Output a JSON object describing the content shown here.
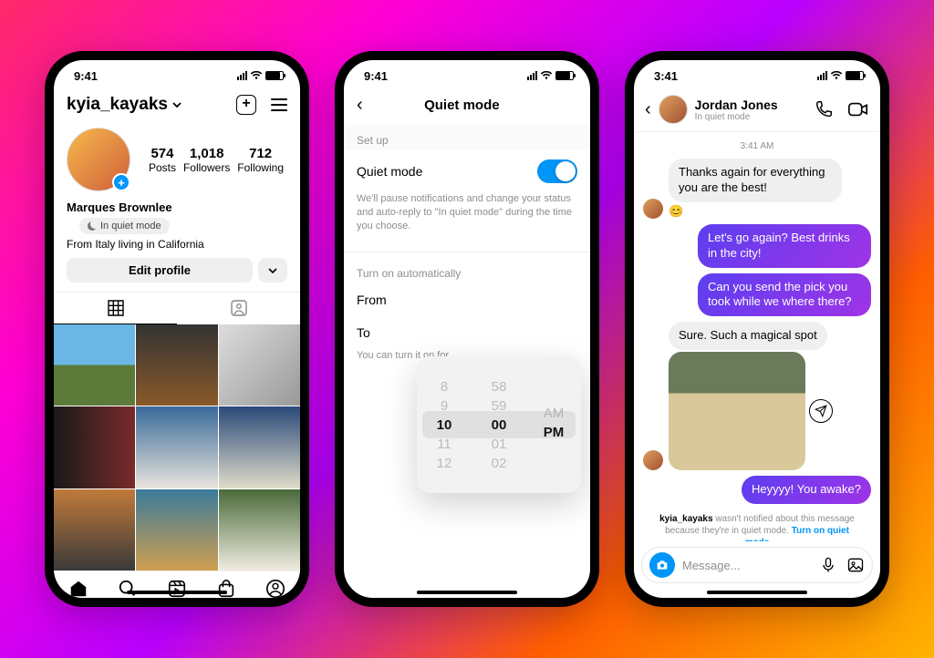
{
  "status": {
    "time1": "9:41",
    "time2": "9:41",
    "time3": "3:41"
  },
  "profile": {
    "username": "kyia_kayaks",
    "stats": [
      {
        "num": "574",
        "label": "Posts"
      },
      {
        "num": "1,018",
        "label": "Followers"
      },
      {
        "num": "712",
        "label": "Following"
      }
    ],
    "display_name": "Marques Brownlee",
    "quiet_label": "In quiet mode",
    "bio": "From Italy living in California",
    "edit_label": "Edit profile"
  },
  "quiet": {
    "title": "Quiet mode",
    "setup": "Set up",
    "row_label": "Quiet mode",
    "desc": "We'll pause notifications and change your status and auto-reply to \"In quiet mode\" during the time you choose.",
    "auto_label": "Turn on automatically",
    "from": "From",
    "to": "To",
    "hint": "You can turn it on for",
    "picker": {
      "hours": [
        "8",
        "9",
        "10",
        "11",
        "12"
      ],
      "mins": [
        "58",
        "59",
        "00",
        "01",
        "02"
      ],
      "ampm": [
        "",
        "AM",
        "PM",
        "",
        ""
      ]
    }
  },
  "chat": {
    "name": "Jordan Jones",
    "status": "In quiet mode",
    "timestamp": "3:41 AM",
    "m1": "Thanks again for everything you are the best!",
    "m2": "Let's go again? Best drinks in the city!",
    "m3": "Can you send the pick you took while we where there?",
    "m4": "Sure. Such a magical spot",
    "m5": "Heyyyy! You awake?",
    "notice_user": "kyia_kayaks",
    "notice_text": " wasn't notified about this message because they're in quiet mode. ",
    "notice_link": "Turn on quiet mode",
    "placeholder": "Message..."
  }
}
